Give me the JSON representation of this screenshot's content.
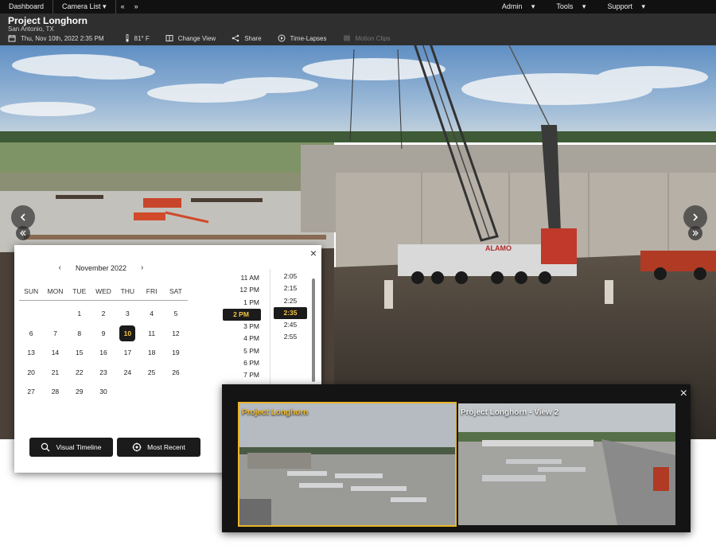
{
  "topnav": {
    "dashboard": "Dashboard",
    "camera_list": "Camera List",
    "collapse": "«",
    "expand": "»",
    "admin": "Admin",
    "tools": "Tools",
    "support": "Support"
  },
  "header": {
    "title": "Project Longhorn",
    "location": "San Antonio, TX",
    "datetime": "Thu, Nov 10th, 2022 2:35 PM",
    "temperature": "81° F",
    "change_view": "Change View",
    "share": "Share",
    "time_lapses": "Time-Lapses",
    "motion_clips": "Motion Clips"
  },
  "calendar": {
    "month_label": "November 2022",
    "prev": "‹",
    "next": "›",
    "close": "×",
    "weekdays": [
      "SUN",
      "MON",
      "TUE",
      "WED",
      "THU",
      "FRI",
      "SAT"
    ],
    "weeks": [
      [
        "",
        "",
        "1",
        "2",
        "3",
        "4",
        "5"
      ],
      [
        "6",
        "7",
        "8",
        "9",
        "10",
        "11",
        "12"
      ],
      [
        "13",
        "14",
        "15",
        "16",
        "17",
        "18",
        "19"
      ],
      [
        "20",
        "21",
        "22",
        "23",
        "24",
        "25",
        "26"
      ],
      [
        "27",
        "28",
        "29",
        "30",
        "",
        "",
        ""
      ]
    ],
    "selected_day": "10",
    "hours": [
      "11 AM",
      "12 PM",
      "1 PM",
      "2 PM",
      "3 PM",
      "4 PM",
      "5 PM",
      "6 PM",
      "7 PM"
    ],
    "selected_hour": "2 PM",
    "minutes": [
      "2:05",
      "2:15",
      "2:25",
      "2:35",
      "2:45",
      "2:55"
    ],
    "selected_minute": "2:35",
    "visual_timeline": "Visual Timeline",
    "most_recent": "Most Recent"
  },
  "cameras": {
    "close": "×",
    "tiles": [
      {
        "label": "Project Longhorn",
        "active": true
      },
      {
        "label": "Project Longhorn - View 2",
        "active": false
      }
    ]
  },
  "scene": {
    "crane_brand": "ALAMO"
  },
  "colors": {
    "accent": "#f5c542",
    "dark": "#1b1b1b",
    "active_outline": "#e8b62a"
  }
}
